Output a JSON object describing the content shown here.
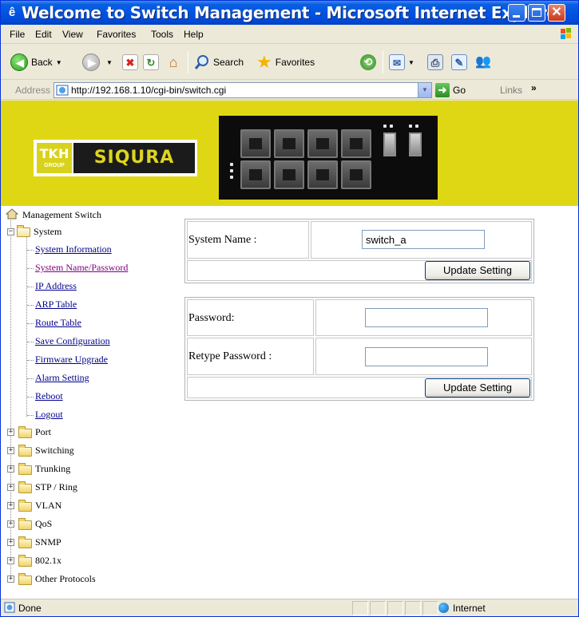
{
  "window": {
    "title": "Welcome to Switch Management - Microsoft Internet Explorer"
  },
  "menubar": {
    "items": [
      "File",
      "Edit",
      "View",
      "Favorites",
      "Tools",
      "Help"
    ]
  },
  "toolbar": {
    "back_label": "Back",
    "search_label": "Search",
    "favorites_label": "Favorites"
  },
  "addressbar": {
    "label": "Address",
    "url": "http://192.168.1.10/cgi-bin/switch.cgi",
    "go_label": "Go",
    "links_label": "Links"
  },
  "banner": {
    "logo_left": "TKH",
    "logo_left_sub": "GROUP",
    "logo_right": "SIQURA"
  },
  "tree": {
    "root": "Management Switch",
    "system": {
      "label": "System",
      "items": [
        "System Information",
        "System Name/Password",
        "IP Address",
        "ARP Table",
        "Route Table",
        "Save Configuration",
        "Firmware Upgrade",
        "Alarm Setting",
        "Reboot",
        "Logout"
      ]
    },
    "folders": [
      "Port",
      "Switching",
      "Trunking",
      "STP / Ring",
      "VLAN",
      "QoS",
      "SNMP",
      "802.1x",
      "Other Protocols"
    ]
  },
  "form_name": {
    "label": "System Name :",
    "value": "switch_a",
    "button": "Update Setting"
  },
  "form_password": {
    "password_label": "Password:",
    "password_value": "",
    "retype_label": "Retype Password :",
    "retype_value": "",
    "button": "Update Setting"
  },
  "statusbar": {
    "status": "Done",
    "zone": "Internet"
  }
}
